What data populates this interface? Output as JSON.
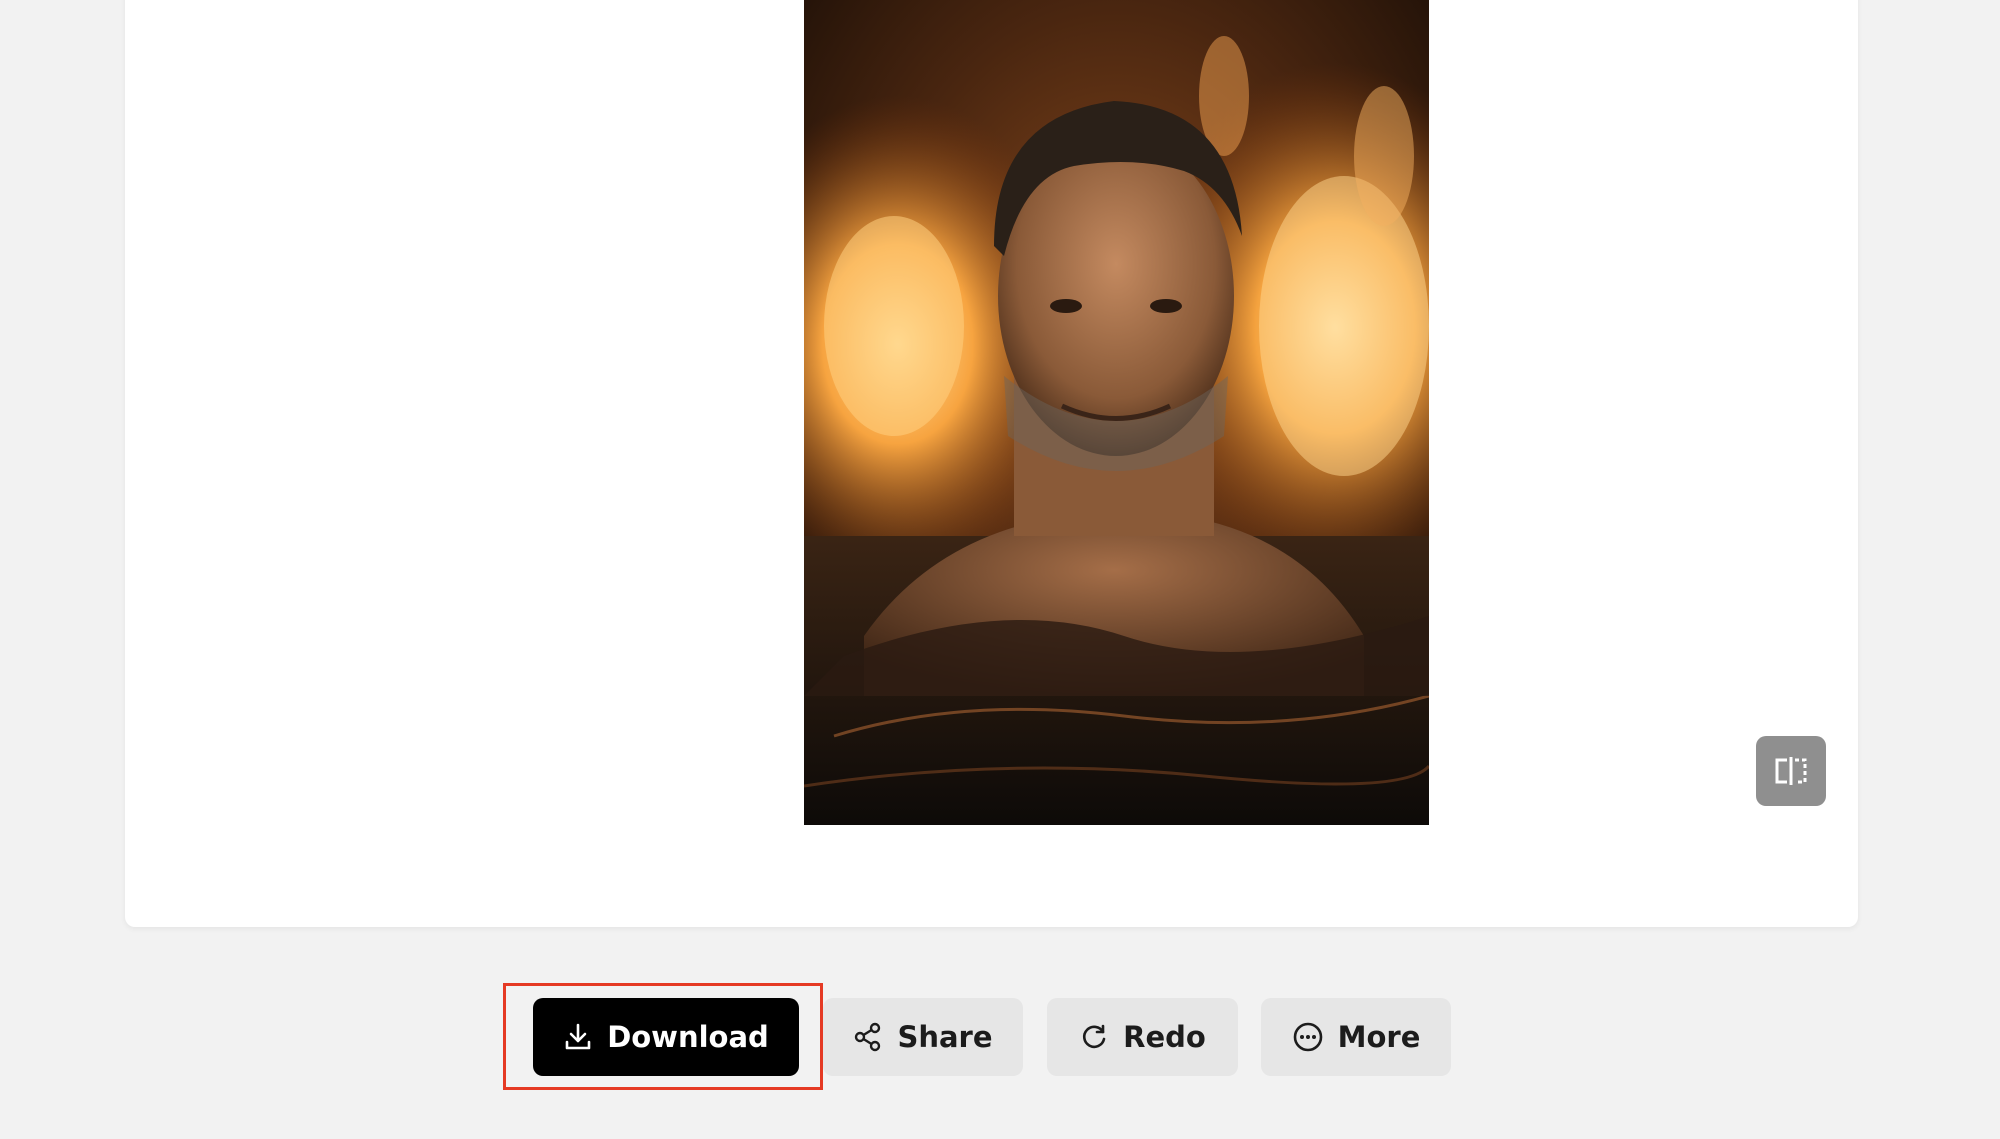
{
  "image": {
    "alt_subject": "portrait-photo"
  },
  "compare": {
    "icon": "compare-split-icon"
  },
  "actions": {
    "download_label": "Download",
    "share_label": "Share",
    "redo_label": "Redo",
    "more_label": "More"
  },
  "icons": {
    "download": "download-icon",
    "share": "share-icon",
    "redo": "redo-icon",
    "more": "more-icon"
  },
  "colors": {
    "background": "#f2f2f2",
    "card": "#ffffff",
    "primary_button": "#000000",
    "secondary_button": "#e6e6e6",
    "highlight": "#e53a24"
  }
}
